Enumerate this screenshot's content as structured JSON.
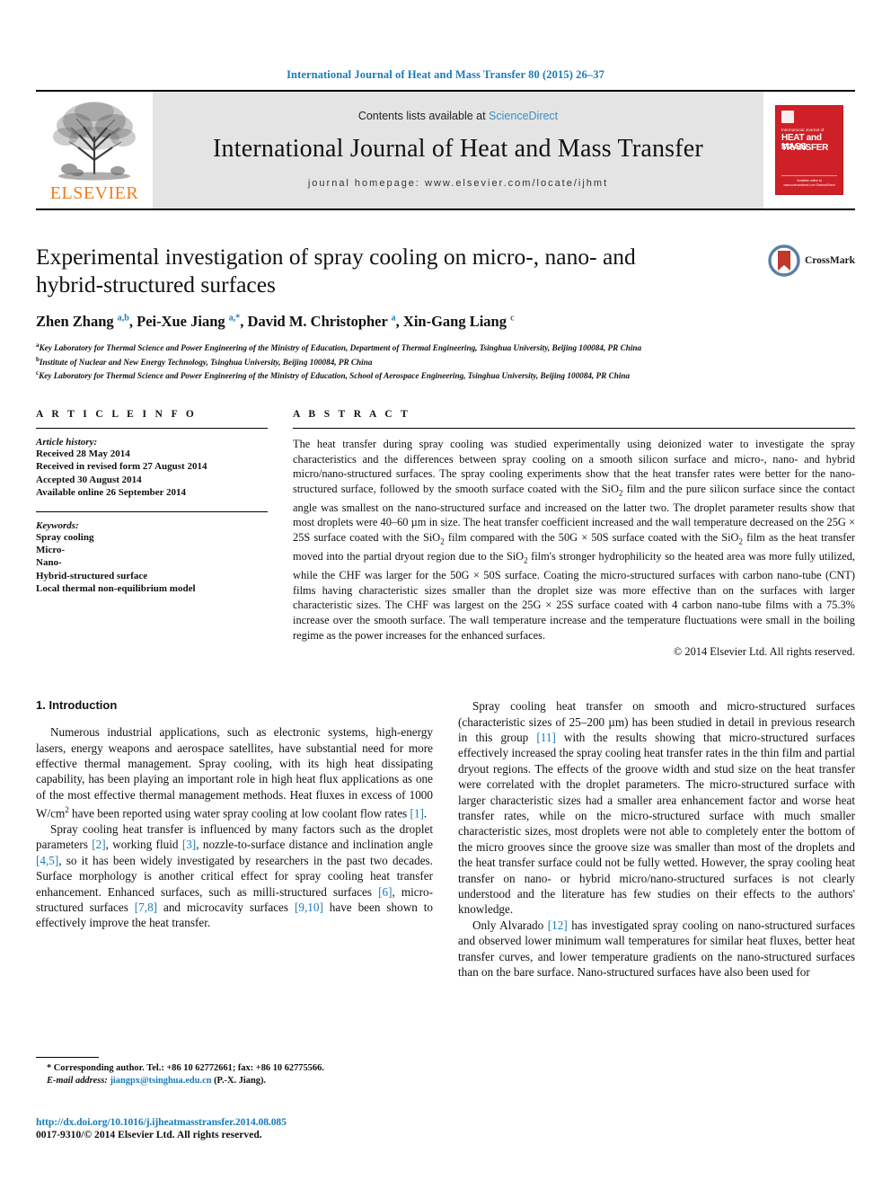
{
  "running_head": "International Journal of Heat and Mass Transfer 80 (2015) 26–37",
  "masthead": {
    "contents_prefix": "Contents lists available at ",
    "sciencedirect": "ScienceDirect",
    "journal_title": "International Journal of Heat and Mass Transfer",
    "homepage": "journal homepage: www.elsevier.com/locate/ijhmt",
    "publisher": "ELSEVIER",
    "cover": {
      "supra": "International Journal of",
      "line1": "HEAT and MASS",
      "line2": "TRANSFER",
      "footer": "Available online at www.sciencedirect.com\nScienceDirect"
    }
  },
  "article": {
    "title": "Experimental investigation of spray cooling on micro-, nano- and hybrid-structured surfaces",
    "authors_html": "Zhen Zhang <sup>a,b</sup>, Pei-Xue Jiang <sup>a,*</sup>, David M. Christopher <sup>a</sup>, Xin-Gang Liang <sup>c</sup>",
    "affiliations": [
      "Key Laboratory for Thermal Science and Power Engineering of the Ministry of Education, Department of Thermal Engineering, Tsinghua University, Beijing 100084, PR China",
      "Institute of Nuclear and New Energy Technology, Tsinghua University, Beijing 100084, PR China",
      "Key Laboratory for Thermal Science and Power Engineering of the Ministry of Education, School of Aerospace Engineering, Tsinghua University, Beijing 100084, PR China"
    ],
    "affiliation_marks": [
      "a",
      "b",
      "c"
    ],
    "crossmark_label": "CrossMark"
  },
  "article_info": {
    "heading": "A R T I C L E    I N F O",
    "history_label": "Article history:",
    "history": [
      "Received 28 May 2014",
      "Received in revised form 27 August 2014",
      "Accepted 30 August 2014",
      "Available online 26 September 2014"
    ],
    "keywords_label": "Keywords:",
    "keywords": [
      "Spray cooling",
      "Micro-",
      "Nano-",
      "Hybrid-structured surface",
      "Local thermal non-equilibrium model"
    ]
  },
  "abstract": {
    "heading": "A B S T R A C T",
    "text_html": "The heat transfer during spray cooling was studied experimentally using deionized water to investigate the spray characteristics and the differences between spray cooling on a smooth silicon surface and micro-, nano- and hybrid micro/nano-structured surfaces. The spray cooling experiments show that the heat transfer rates were better for the nano-structured surface, followed by the smooth surface coated with the SiO<sub class=\"sub\">2</sub> film and the pure silicon surface since the contact angle was smallest on the nano-structured surface and increased on the latter two. The droplet parameter results show that most droplets were 40–60 &#181;m in size. The heat transfer coefficient increased and the wall temperature decreased on the 25G &#215; 25S surface coated with the SiO<sub class=\"sub\">2</sub> film compared with the 50G &#215; 50S surface coated with the SiO<sub class=\"sub\">2</sub> film as the heat transfer moved into the partial dryout region due to the SiO<sub class=\"sub\">2</sub> film's stronger hydrophilicity so the heated area was more fully utilized, while the CHF was larger for the 50G &#215; 50S surface. Coating the micro-structured surfaces with carbon nano-tube (CNT) films having characteristic sizes smaller than the droplet size was more effective than on the surfaces with larger characteristic sizes. The CHF was largest on the 25G &#215; 25S surface coated with 4 carbon nano-tube films with a 75.3% increase over the smooth surface. The wall temperature increase and the temperature fluctuations were small in the boiling regime as the power increases for the enhanced surfaces.",
    "copyright": "© 2014 Elsevier Ltd. All rights reserved."
  },
  "body": {
    "section_heading": "1. Introduction",
    "left_paragraphs_html": [
      "Numerous industrial applications, such as electronic systems, high-energy lasers, energy weapons and aerospace satellites, have substantial need for more effective thermal management. Spray cooling, with its high heat dissipating capability, has been playing an important role in high heat flux applications as one of the most effective thermal management methods. Heat fluxes in excess of 1000 W/cm<sup class=\"sup\">2</sup> have been reported using water spray cooling at low coolant flow rates <span class=\"ref\">[1]</span>.",
      "Spray cooling heat transfer is influenced by many factors such as the droplet parameters <span class=\"ref\">[2]</span>, working fluid <span class=\"ref\">[3]</span>, nozzle-to-surface distance and inclination angle <span class=\"ref\">[4,5]</span>, so it has been widely investigated by researchers in the past two decades. Surface morphology is another critical effect for spray cooling heat transfer enhancement. Enhanced surfaces, such as milli-structured surfaces <span class=\"ref\">[6]</span>, micro-structured surfaces <span class=\"ref\">[7,8]</span> and microcavity surfaces <span class=\"ref\">[9,10]</span> have been shown to effectively improve the heat transfer."
    ],
    "right_paragraphs_html": [
      "Spray cooling heat transfer on smooth and micro-structured surfaces (characteristic sizes of 25–200 &#181;m) has been studied in detail in previous research in this group <span class=\"ref\">[11]</span> with the results showing that micro-structured surfaces effectively increased the spray cooling heat transfer rates in the thin film and partial dryout regions. The effects of the groove width and stud size on the heat transfer were correlated with the droplet parameters. The micro-structured surface with larger characteristic sizes had a smaller area enhancement factor and worse heat transfer rates, while on the micro-structured surface with much smaller characteristic sizes, most droplets were not able to completely enter the bottom of the micro grooves since the groove size was smaller than most of the droplets and the heat transfer surface could not be fully wetted. However, the spray cooling heat transfer on nano- or hybrid micro/nano-structured surfaces is not clearly understood and the literature has few studies on their effects to the authors' knowledge.",
      "Only Alvarado <span class=\"ref\">[12]</span> has investigated spray cooling on nano-structured surfaces and observed lower minimum wall temperatures for similar heat fluxes, better heat transfer curves, and lower temperature gradients on the nano-structured surfaces than on the bare surface. Nano-structured surfaces have also been used for"
    ]
  },
  "footnote": {
    "corresponding_html": "* Corresponding author. Tel.: +86 10 62772661; fax: +86 10 62775566.",
    "email_label": "E-mail address:",
    "email": "jiangpx@tsinghua.edu.cn",
    "email_suffix": "(P.-X. Jiang).",
    "doi": "http://dx.doi.org/10.1016/j.ijheatmasstransfer.2014.08.085",
    "issn": "0017-9310/© 2014 Elsevier Ltd. All rights reserved."
  },
  "colors": {
    "link_blue": "#1a7bb9",
    "elsevier_orange": "#ef7d1a",
    "cover_red": "#cf2027",
    "masthead_grey": "#e4e4e4"
  }
}
